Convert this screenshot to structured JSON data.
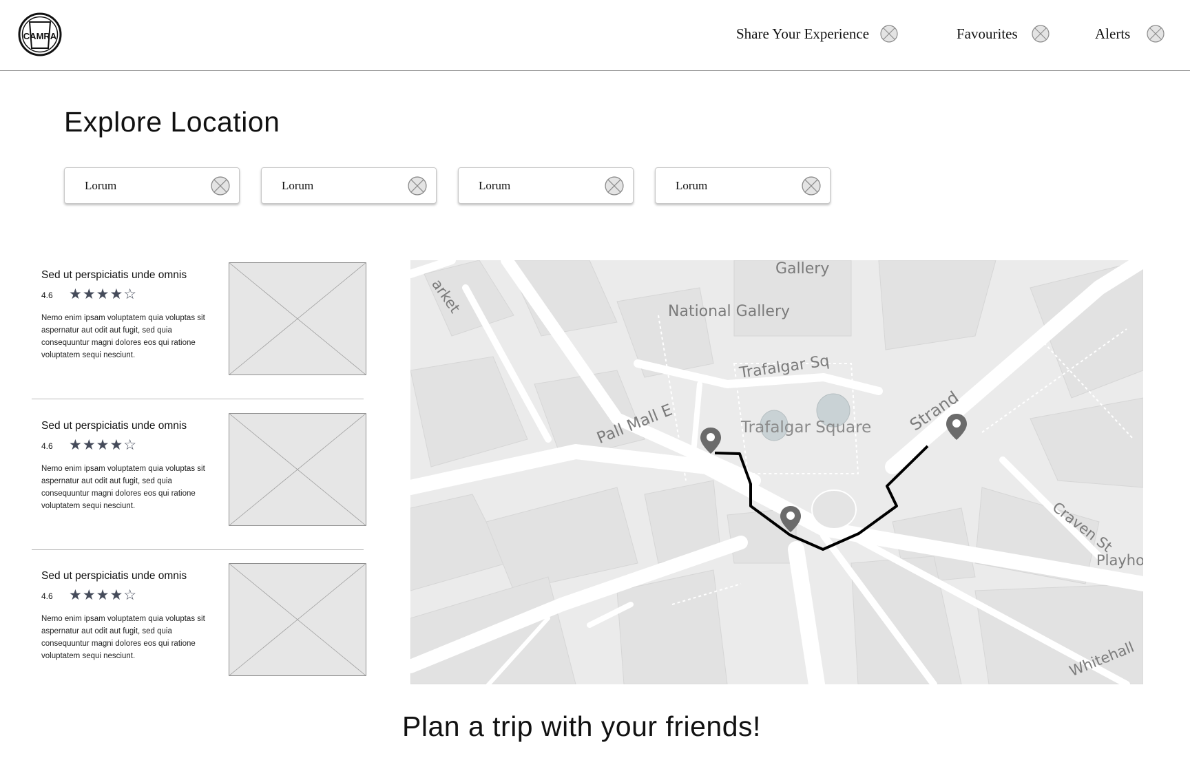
{
  "header": {
    "logo_text": "CAMRA",
    "nav": [
      {
        "label": "Share Your Experience"
      },
      {
        "label": "Favourites"
      },
      {
        "label": "Alerts"
      }
    ]
  },
  "main": {
    "title": "Explore Location",
    "filters": [
      {
        "label": "Lorum"
      },
      {
        "label": "Lorum"
      },
      {
        "label": "Lorum"
      },
      {
        "label": "Lorum"
      }
    ]
  },
  "results": [
    {
      "title": "Sed ut perspiciatis unde omnis",
      "rating": "4.6",
      "stars": "★★★★☆",
      "description": "Nemo enim ipsam voluptatem quia voluptas sit aspernatur aut odit aut fugit, sed quia consequuntur magni dolores eos qui ratione voluptatem sequi nesciunt."
    },
    {
      "title": "Sed ut perspiciatis unde omnis",
      "rating": "4.6",
      "stars": "★★★★☆",
      "description": "Nemo enim ipsam voluptatem quia voluptas sit aspernatur aut odit aut fugit, sed quia consequuntur magni dolores eos qui ratione voluptatem sequi nesciunt."
    },
    {
      "title": "Sed ut perspiciatis unde omnis",
      "rating": "4.6",
      "stars": "★★★★☆",
      "description": "Nemo enim ipsam voluptatem quia voluptas sit aspernatur aut odit aut fugit, sed quia consequuntur magni dolores eos qui ratione voluptatem sequi nesciunt."
    }
  ],
  "map": {
    "labels": {
      "gallery": "Gallery",
      "national_gallery": "National Gallery",
      "trafalgar_sq": "Trafalgar Sq",
      "trafalgar_square": "Trafalgar Square",
      "pall_mall_e": "Pall Mall E",
      "strand": "Strand",
      "craven_st": "Craven St",
      "playhouse": "Playho",
      "whitehall": "Whitehall",
      "market": "arket"
    }
  },
  "footer": {
    "cta": "Plan a trip with your friends!"
  },
  "colors": {
    "star": "#454b5a",
    "placeholder_fill": "#e6e6e6",
    "map_bg": "#ececec",
    "route": "#000000",
    "pin": "#6b6b6b"
  }
}
